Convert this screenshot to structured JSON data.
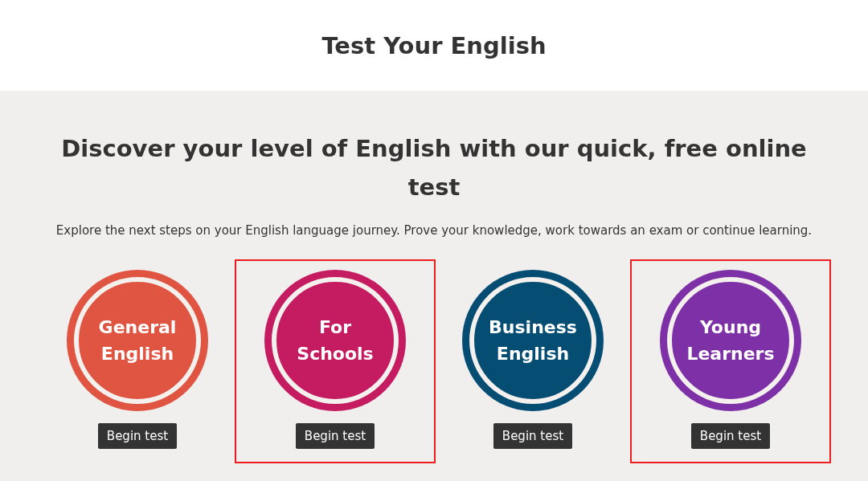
{
  "header": {
    "title": "Test Your English"
  },
  "intro": {
    "heading": "Discover your level of English with our quick, free online test",
    "text": "Explore the next steps on your English language journey. Prove your knowledge, work towards an exam or continue learning."
  },
  "cards": [
    {
      "label": "General English",
      "color": "#e05442",
      "button": "Begin test",
      "highlighted": false
    },
    {
      "label": "For Schools",
      "color": "#c51b61",
      "button": "Begin test",
      "highlighted": true
    },
    {
      "label": "Business English",
      "color": "#054d73",
      "button": "Begin test",
      "highlighted": false
    },
    {
      "label": "Young Learners",
      "color": "#7e30a6",
      "button": "Begin test",
      "highlighted": true
    }
  ]
}
